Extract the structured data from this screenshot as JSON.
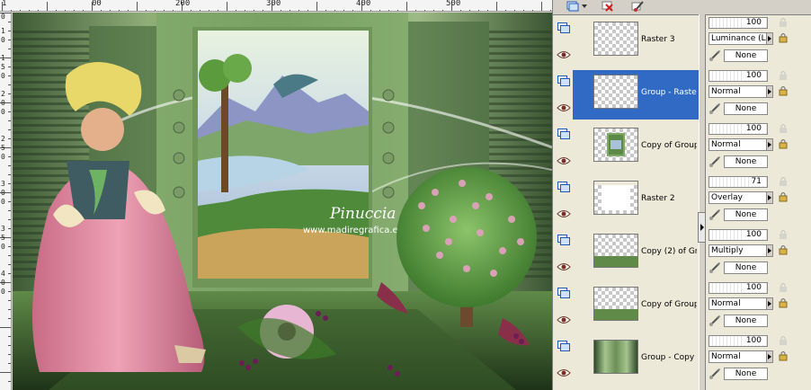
{
  "rulers": {
    "top_labels": [
      "1",
      "00",
      "200",
      "300",
      "400",
      "500"
    ],
    "left_labels": [
      "0",
      "1",
      "0",
      "1",
      "5",
      "0",
      "2",
      "0",
      "0",
      "2",
      "5",
      "0",
      "3",
      "0",
      "0",
      "3",
      "5",
      "0",
      "4",
      "0",
      "0"
    ]
  },
  "canvas": {
    "watermark_name": "Pinuccia",
    "watermark_url": "www.madiregrafica.eu"
  },
  "toolbar": {
    "buttons": [
      "new-layer-icon",
      "delete-layer-icon",
      "layer-properties-icon"
    ]
  },
  "layers": [
    {
      "name": "Raster 3",
      "opacity": "100",
      "blend": "Luminance (L)",
      "group": "None",
      "thumb": "transparent",
      "selected": false
    },
    {
      "name": "Group - Raster",
      "opacity": "100",
      "blend": "Normal",
      "group": "None",
      "thumb": "transparent",
      "selected": true
    },
    {
      "name": "Copy of Group",
      "opacity": "100",
      "blend": "Normal",
      "group": "None",
      "thumb": "picture",
      "selected": false
    },
    {
      "name": "Raster 2",
      "opacity": "71",
      "blend": "Overlay",
      "group": "None",
      "thumb": "white",
      "selected": false
    },
    {
      "name": "Copy (2) of Gr",
      "opacity": "100",
      "blend": "Multiply",
      "group": "None",
      "thumb": "floor",
      "selected": false
    },
    {
      "name": "Copy of Group",
      "opacity": "100",
      "blend": "Normal",
      "group": "None",
      "thumb": "floor",
      "selected": false
    },
    {
      "name": "Group - Copy",
      "opacity": "100",
      "blend": "Normal",
      "group": "None",
      "thumb": "green",
      "selected": false
    }
  ],
  "colors": {
    "selection": "#316ac5",
    "panel_bg": "#ece9d8",
    "chrome": "#d4d0c8"
  }
}
